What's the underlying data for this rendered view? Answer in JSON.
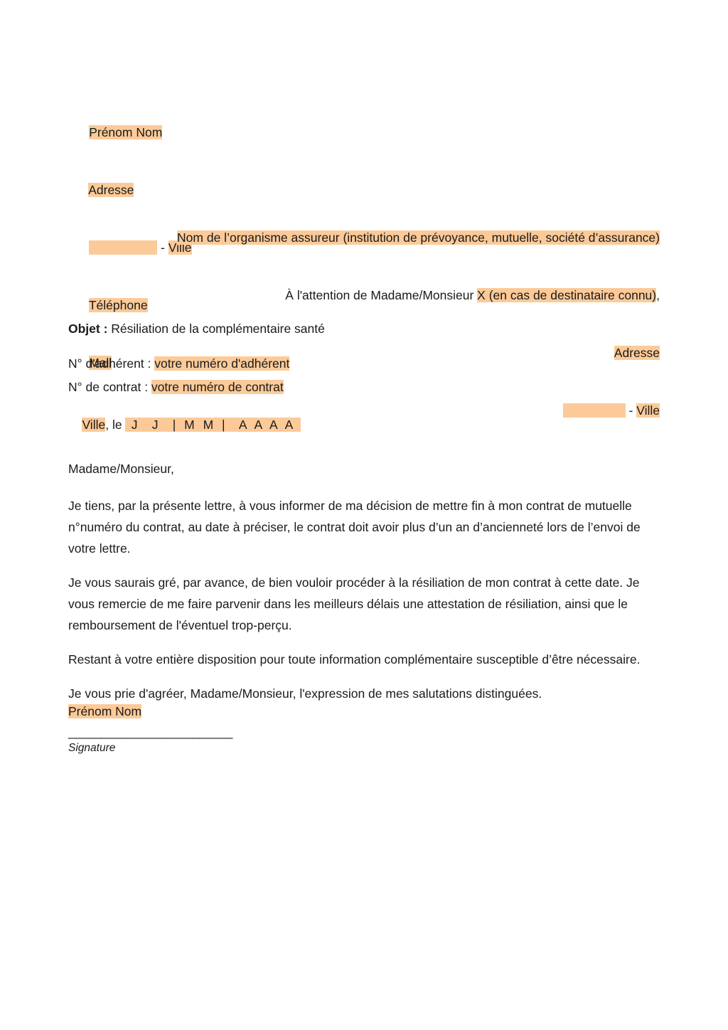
{
  "colors": {
    "highlight": "#fcca98",
    "text": "#1a1a1a",
    "page_background": "#ffffff"
  },
  "sender": {
    "name": "Prénom Nom",
    "address": "Adresse",
    "postal_code": "",
    "city_separator": " - ",
    "city": "Ville",
    "phone": "Téléphone",
    "mail": "Mail"
  },
  "recipient": {
    "organisation": "Nom de l’organisme assureur (institution de prévoyance, mutuelle, société d’assurance)",
    "attention_prefix": "À l'attention de Madame/Monsieur ",
    "attention_placeholder": "X (en cas de destinataire connu)",
    "attention_suffix": ",",
    "address": "Adresse",
    "postal_code": "",
    "city_separator": " - ",
    "city": "Ville"
  },
  "subject": {
    "label": "Objet :",
    "value": " Résiliation de la complémentaire santé",
    "member_number_label": "N° d'adhérent : ",
    "member_number_value": "votre numéro d'adhérent",
    "contract_number_label": "N° de contrat : ",
    "contract_number_value": "votre numéro de contrat"
  },
  "date_line": {
    "city": "Ville",
    "separator": ", le ",
    "template": " J  J  | M M |  A A A A "
  },
  "letter": {
    "salutation": "Madame/Monsieur,",
    "paragraph_1": "Je tiens, par la présente lettre, à vous informer de ma décision de mettre fin à mon contrat de mutuelle n°numéro du contrat, au date à préciser, le contrat doit avoir plus d’un an d’ancienneté lors de l’envoi de votre lettre.",
    "paragraph_2": "Je vous saurais gré, par avance, de bien vouloir procéder à la résiliation de mon contrat à cette date. Je vous remercie de me faire parvenir dans les meilleurs délais une attestation de résiliation, ainsi que le remboursement de l'éventuel trop-perçu.",
    "paragraph_3": "Restant à votre entière disposition pour toute information complémentaire susceptible d’être nécessaire.",
    "closing": "Je vous prie d'agréer, Madame/Monsieur, l'expression de mes salutations distinguées."
  },
  "signature": {
    "name": "Prénom Nom",
    "rule": "_________________________",
    "caption": "Signature"
  }
}
